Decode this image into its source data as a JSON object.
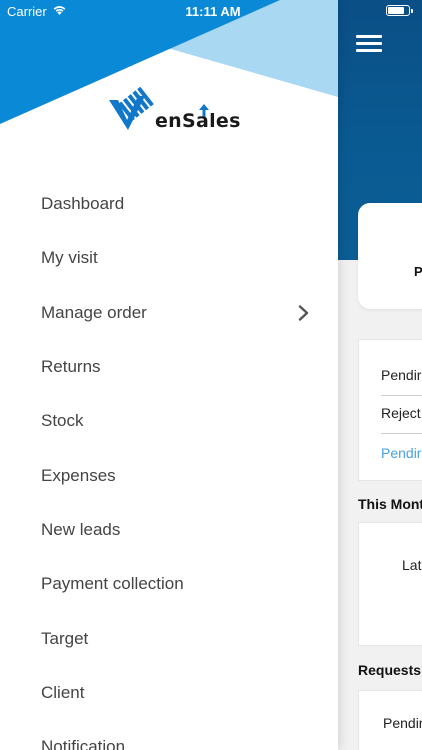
{
  "status_bar": {
    "carrier": "Carrier",
    "time": "11:11 AM"
  },
  "logo": {
    "text": "enSales",
    "icon": "vensales-logo-mark"
  },
  "menu": {
    "items": [
      {
        "label": "Dashboard"
      },
      {
        "label": "My visit"
      },
      {
        "label": "Manage order",
        "has_submenu": true
      },
      {
        "label": "Returns"
      },
      {
        "label": "Stock"
      },
      {
        "label": "Expenses"
      },
      {
        "label": "New leads"
      },
      {
        "label": "Payment collection"
      },
      {
        "label": "Target"
      },
      {
        "label": "Client"
      },
      {
        "label": "Notification"
      }
    ]
  },
  "background_app": {
    "card_top_text": "P",
    "list_rows": [
      "Pendir",
      "Reject",
      "Pendir"
    ],
    "section_this_month": "This Mont",
    "month_card_text": "Lat",
    "section_requests": "Requests",
    "requests_row": "Pendir"
  },
  "colors": {
    "primary_blue": "#0a5b93",
    "header_triangle_blue": "#0a8ad6",
    "light_blue": "#a9d8f2",
    "link_blue": "#4aa3df"
  }
}
